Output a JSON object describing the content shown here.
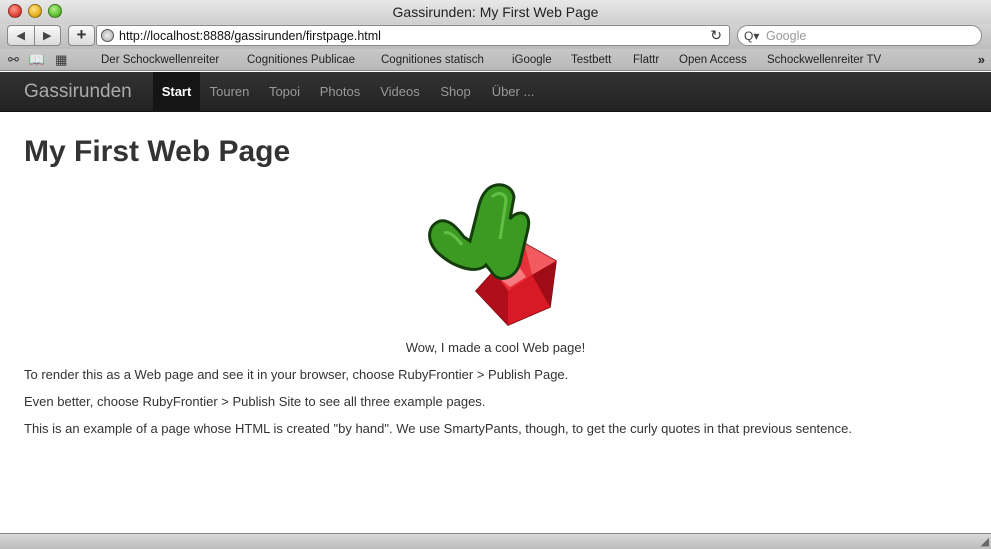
{
  "window": {
    "title": "Gassirunden: My First Web Page"
  },
  "toolbar": {
    "back_icon": "◀",
    "forward_icon": "▶",
    "add_icon": "+",
    "url": "http://localhost:8888/gassirunden/firstpage.html",
    "reload_icon": "↻",
    "search_placeholder": "Google",
    "search_icon": "Q▾"
  },
  "bookmarks": {
    "items": [
      "Der Schockwellenreiter",
      "Cognitiones Publicae",
      "Cognitiones statisch",
      "iGoogle",
      "Testbett",
      "Flattr",
      "Open Access",
      "Schockwellenreiter TV"
    ],
    "more_icon": "»"
  },
  "site": {
    "brand": "Gassirunden",
    "nav": [
      "Start",
      "Touren",
      "Topoi",
      "Photos",
      "Videos",
      "Shop",
      "Über ..."
    ],
    "active_nav": "Start"
  },
  "page": {
    "heading": "My First Web Page",
    "image": "cactus-ruby-logo",
    "caption": "Wow, I made a cool Web page!",
    "paragraphs": [
      "To render this as a Web page and see it in your browser, choose RubyFrontier > Publish Page.",
      "Even better, choose RubyFrontier > Publish Site to see all three example pages.",
      "This is an example of a page whose HTML is created \"by hand\". We use SmartyPants, though, to get the curly quotes in that previous sentence."
    ]
  },
  "colors": {
    "navbar_bg": "#222222",
    "heading_text": "#333333",
    "cactus_green": "#3a9a22",
    "ruby_red": "#d0101e"
  }
}
